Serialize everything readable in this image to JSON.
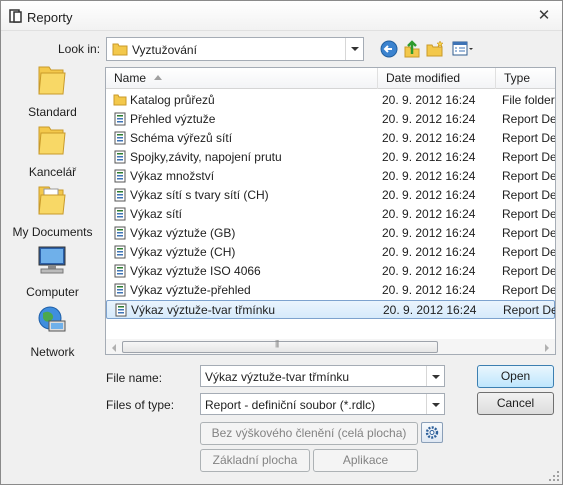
{
  "window": {
    "title": "Reporty",
    "close_glyph": "✕"
  },
  "lookin": {
    "label": "Look in:",
    "value": "Vyztužování"
  },
  "toolbar": {
    "back_icon": "back-arrow-icon",
    "up_icon": "up-folder-icon",
    "new_folder_icon": "new-folder-icon",
    "view_icon": "view-menu-icon"
  },
  "places": [
    {
      "label": "Standard",
      "icon": "folder-icon"
    },
    {
      "label": "Kancelář",
      "icon": "folder-icon"
    },
    {
      "label": "My Documents",
      "icon": "documents-folder-icon"
    },
    {
      "label": "Computer",
      "icon": "computer-icon"
    },
    {
      "label": "Network",
      "icon": "network-icon"
    }
  ],
  "columns": {
    "name": "Name",
    "date": "Date modified",
    "type": "Type"
  },
  "files": [
    {
      "name": "Katalog průřezů",
      "date": "20. 9. 2012 16:24",
      "type": "File folder",
      "kind": "folder"
    },
    {
      "name": "Přehled výztuže",
      "date": "20. 9. 2012 16:24",
      "type": "Report De",
      "kind": "report"
    },
    {
      "name": "Schéma výřezů sítí",
      "date": "20. 9. 2012 16:24",
      "type": "Report De",
      "kind": "report"
    },
    {
      "name": "Spojky,závity, napojení prutu",
      "date": "20. 9. 2012 16:24",
      "type": "Report De",
      "kind": "report"
    },
    {
      "name": "Výkaz množství",
      "date": "20. 9. 2012 16:24",
      "type": "Report De",
      "kind": "report"
    },
    {
      "name": "Výkaz sítí s tvary sítí (CH)",
      "date": "20. 9. 2012 16:24",
      "type": "Report De",
      "kind": "report"
    },
    {
      "name": "Výkaz sítí",
      "date": "20. 9. 2012 16:24",
      "type": "Report De",
      "kind": "report"
    },
    {
      "name": "Výkaz výztuže (GB)",
      "date": "20. 9. 2012 16:24",
      "type": "Report De",
      "kind": "report"
    },
    {
      "name": "Výkaz výztuže (CH)",
      "date": "20. 9. 2012 16:24",
      "type": "Report De",
      "kind": "report"
    },
    {
      "name": "Výkaz výztuže ISO 4066",
      "date": "20. 9. 2012 16:24",
      "type": "Report De",
      "kind": "report"
    },
    {
      "name": "Výkaz výztuže-přehled",
      "date": "20. 9. 2012 16:24",
      "type": "Report De",
      "kind": "report"
    },
    {
      "name": "Výkaz výztuže-tvar třmínku",
      "date": "20. 9. 2012 16:24",
      "type": "Report De",
      "kind": "report",
      "selected": true
    }
  ],
  "filename": {
    "label": "File name:",
    "value": "Výkaz výztuže-tvar třmínku"
  },
  "filetype": {
    "label": "Files of type:",
    "value": "Report - definiční soubor (*.rdlc)"
  },
  "buttons": {
    "open": "Open",
    "cancel": "Cancel",
    "full_area": "Bez výškového členění (celá plocha)",
    "base_area": "Základní plocha",
    "apply": "Aplikace"
  },
  "colors": {
    "selection_border": "#7da2ce",
    "accent": "#3c7fb1"
  }
}
